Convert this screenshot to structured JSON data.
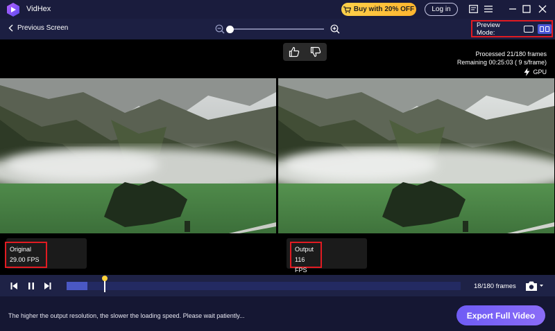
{
  "app": {
    "name": "VidHex"
  },
  "titlebar": {
    "buy_label": "Buy with 20% OFF",
    "login_label": "Log in",
    "icons": [
      "feedback-icon",
      "menu-icon",
      "minimize-icon",
      "maximize-icon",
      "close-icon"
    ]
  },
  "toolbar": {
    "back_label": "Previous Screen",
    "zoom_level": 0,
    "preview_mode_label": "Preview Mode:"
  },
  "preview": {
    "processed_text": "Processed 21/180 frames",
    "remaining_text": "Remaining 00:25:03 ( 9 s/frame)",
    "gpu_label": "GPU",
    "original": {
      "label": "Original",
      "fps": "29.00 FPS"
    },
    "output": {
      "label": "Output",
      "fps": "116 FPS"
    }
  },
  "timeline": {
    "frames_text": "18/180 frames",
    "current_frame": 18,
    "total_frames": 180,
    "processed_frames": 21
  },
  "footer": {
    "hint": "The higher the output resolution, the slower the loading speed. Please wait patiently...",
    "export_label": "Export Full Video"
  },
  "colors": {
    "accent": "#6f5cf5",
    "highlight": "#e21b22",
    "buy": "#ffc23a"
  }
}
